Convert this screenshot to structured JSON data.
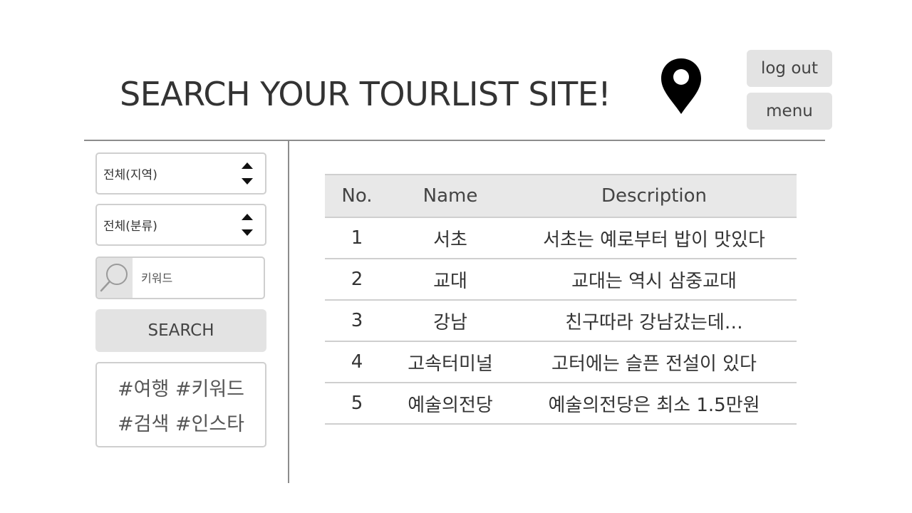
{
  "header": {
    "title": "SEARCH YOUR TOURLIST SITE!",
    "location_icon": "map-pin-icon",
    "logout_label": "log out",
    "menu_label": "menu"
  },
  "sidebar": {
    "region_select": {
      "selected": "전체(지역)"
    },
    "category_select": {
      "selected": "전체(분류)"
    },
    "search": {
      "icon": "search-icon",
      "placeholder": "키워드",
      "value": ""
    },
    "search_button_label": "SEARCH",
    "hashtags": [
      "#여행 #키워드",
      "#검색 #인스타"
    ]
  },
  "table": {
    "columns": [
      "No.",
      "Name",
      "Description"
    ],
    "rows": [
      {
        "no": "1",
        "name": "서초",
        "description": "서초는 예로부터 밥이 맛있다"
      },
      {
        "no": "2",
        "name": "교대",
        "description": "교대는 역시 삼중교대"
      },
      {
        "no": "3",
        "name": "강남",
        "description": "친구따라 강남갔는데…"
      },
      {
        "no": "4",
        "name": "고속터미널",
        "description": "고터에는 슬픈 전설이 있다"
      },
      {
        "no": "5",
        "name": "예술의전당",
        "description": "예술의전당은 최소 1.5만원"
      }
    ]
  },
  "colors": {
    "button_bg": "#e3e3e3",
    "header_bg": "#e8e8e8",
    "border": "#cfcfcf",
    "divider": "#8c8c8c",
    "text": "#333333"
  }
}
